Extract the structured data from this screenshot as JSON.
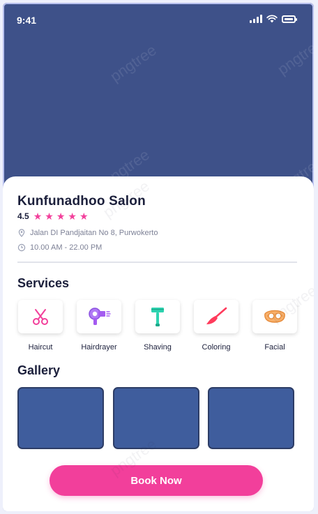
{
  "status_bar": {
    "time": "9:41"
  },
  "salon": {
    "name": "Kunfunadhoo Salon",
    "rating": "4.5",
    "stars": 5,
    "address": "Jalan DI Pandjaitan No 8, Purwokerto",
    "hours": "10.00 AM - 22.00 PM"
  },
  "services": {
    "title": "Services",
    "items": [
      {
        "label": "Haircut",
        "icon": "scissors-icon",
        "color": "#f23f9b"
      },
      {
        "label": "Hairdrayer",
        "icon": "hairdryer-icon",
        "color": "#a45bf0"
      },
      {
        "label": "Shaving",
        "icon": "razor-icon",
        "color": "#2ed3b0"
      },
      {
        "label": "Coloring",
        "icon": "brush-icon",
        "color": "#ff3b5c"
      },
      {
        "label": "Facial",
        "icon": "face-mask-icon",
        "color": "#f5a356"
      }
    ]
  },
  "gallery": {
    "title": "Gallery",
    "count": 3
  },
  "cta": {
    "label": "Book Now"
  },
  "colors": {
    "hero": "#3e5189",
    "accent": "#f23f9b",
    "gallery_tile": "#3f5d9d",
    "text_dark": "#1b1f3b",
    "text_muted": "#7d8196"
  },
  "watermark": "pngtree"
}
